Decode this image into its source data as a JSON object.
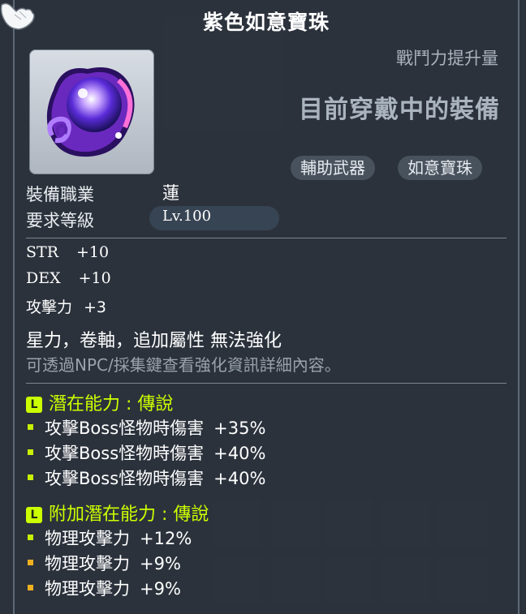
{
  "item": {
    "name": "紫色如意寶珠",
    "power_label": "戰鬥力提升量",
    "equipped_label": "目前穿戴中的裝備",
    "tags": [
      "輔助武器",
      "如意寶珠"
    ]
  },
  "requirements": {
    "job_label": "裝備職業",
    "job_value": "蓮",
    "level_label": "要求等級",
    "level_value": "Lv.100"
  },
  "stats": [
    {
      "name": "STR",
      "value": "+10"
    },
    {
      "name": "DEX",
      "value": "+10"
    },
    {
      "name": "攻擊力",
      "value": "+3"
    }
  ],
  "notes": {
    "no_enhance": "星力，卷軸，追加屬性 無法強化",
    "hint": "可透過NPC/採集鍵查看強化資訊詳細內容。"
  },
  "potential": {
    "badge": "L",
    "title": "潛在能力 : 傳說",
    "lines": [
      {
        "name": "攻擊Boss怪物時傷害",
        "value": "+35%"
      },
      {
        "name": "攻擊Boss怪物時傷害",
        "value": "+40%"
      },
      {
        "name": "攻擊Boss怪物時傷害",
        "value": "+40%"
      }
    ]
  },
  "additional_potential": {
    "badge": "L",
    "title": "附加潛在能力 : 傳說",
    "lines": [
      {
        "name": "物理攻擊力",
        "value": "+12%"
      },
      {
        "name": "物理攻擊力",
        "value": "+9%"
      },
      {
        "name": "物理攻擊力",
        "value": "+9%"
      }
    ]
  },
  "colors": {
    "legendary": "#ccff00",
    "bullet_green": "#c8f000",
    "bullet_orange": "#f0b020"
  },
  "icons": {
    "item": "purple-orb-icon",
    "cursor": "white-glove-cursor-icon"
  }
}
